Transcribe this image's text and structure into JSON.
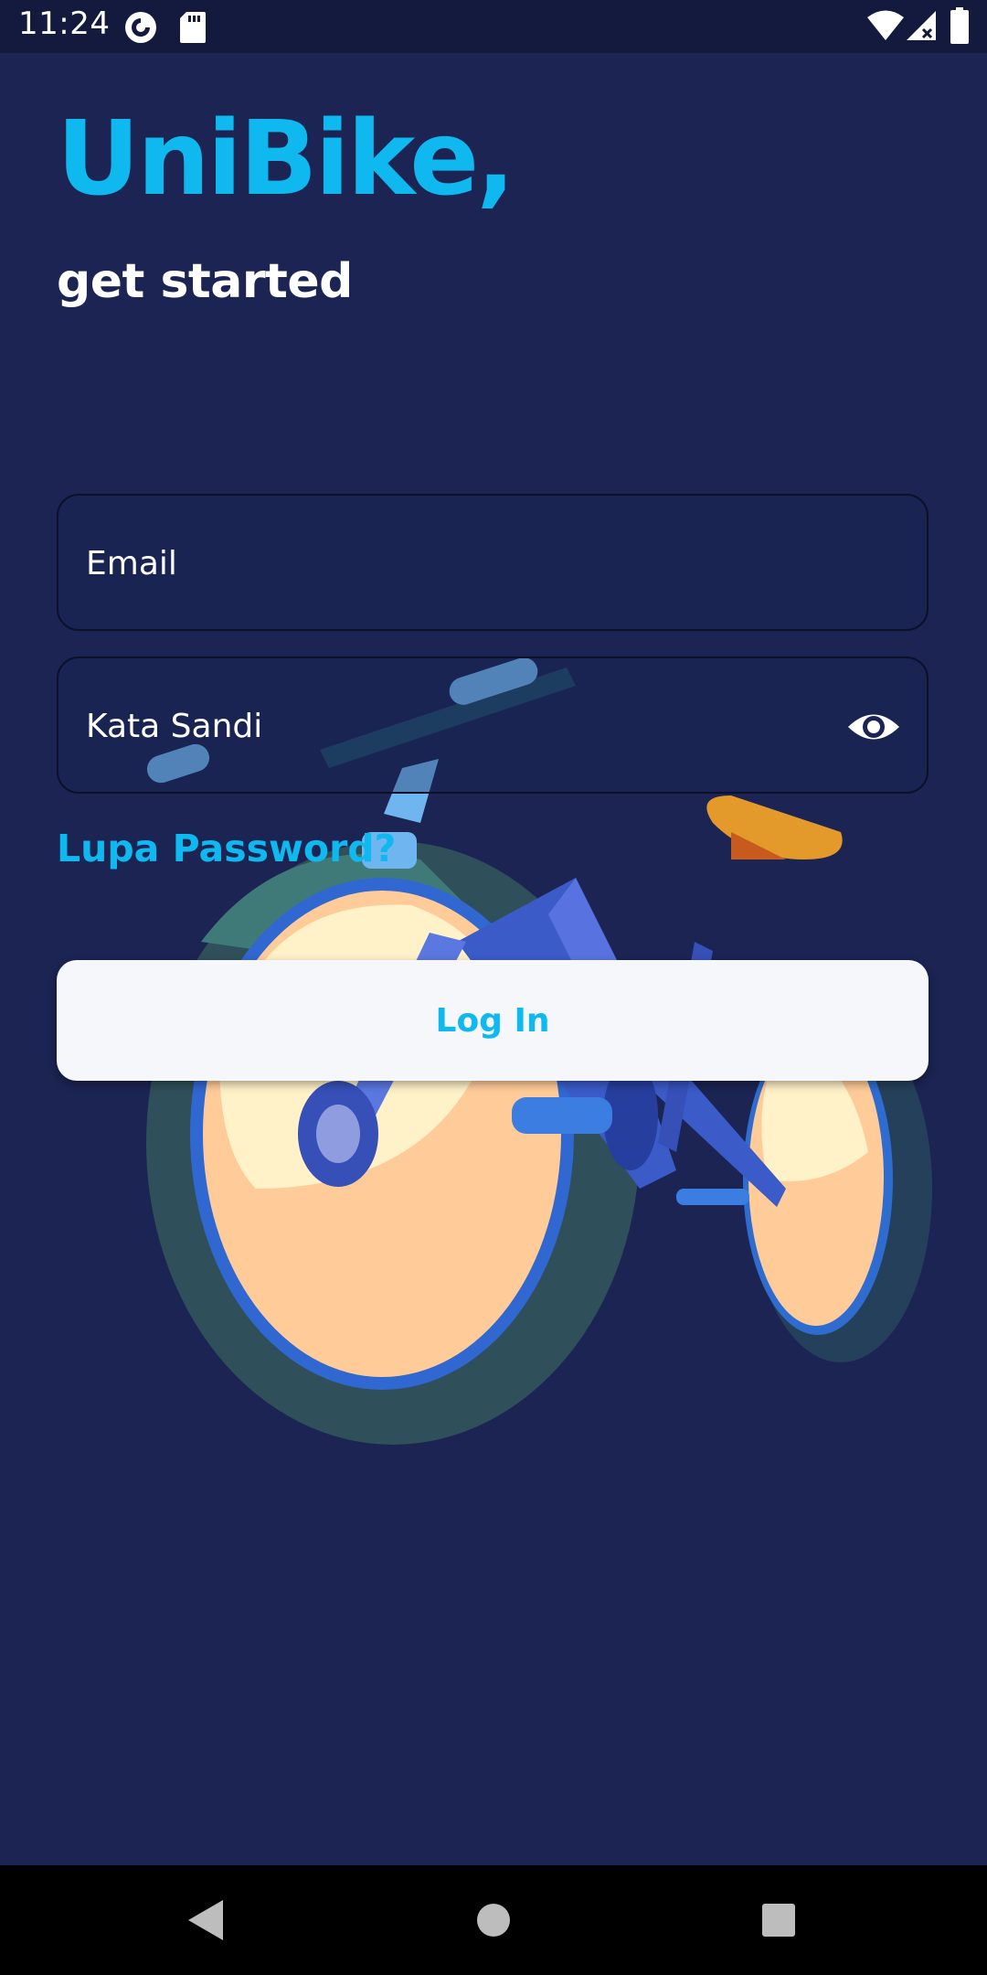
{
  "status_bar": {
    "time": "11:24",
    "icons": [
      "pocket-casts-icon",
      "sd-card-icon",
      "wifi-icon",
      "signal-icon",
      "battery-icon"
    ]
  },
  "header": {
    "title": "UniBike,",
    "subtitle": "get started"
  },
  "form": {
    "email_placeholder": "Email",
    "password_placeholder": "Kata Sandi",
    "password_toggle_icon": "eye-icon",
    "forgot_password": "Lupa Password?",
    "login_label": "Log In"
  },
  "navigation_bar": {
    "buttons": [
      "back-icon",
      "home-icon",
      "recents-icon"
    ]
  },
  "colors": {
    "background": "#1b2453",
    "status_bar": "#131a3e",
    "accent": "#0fb8ef",
    "button_bg": "#f6f7fa",
    "text": "#ffffff"
  }
}
